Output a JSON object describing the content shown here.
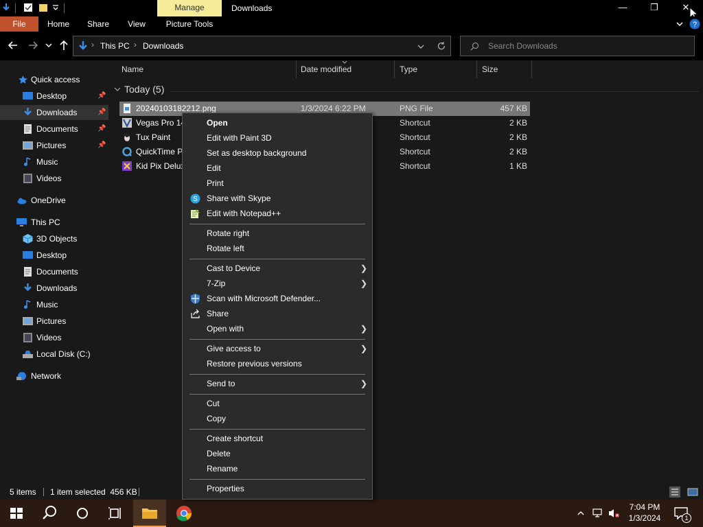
{
  "window": {
    "manage_tab": "Manage",
    "title": "Downloads",
    "minimize": "—",
    "restore": "❐",
    "close": "✕"
  },
  "ribbon": {
    "file": "File",
    "home": "Home",
    "share": "Share",
    "view": "View",
    "picture_tools": "Picture Tools"
  },
  "address": {
    "crumbs": [
      "This PC",
      "Downloads"
    ],
    "search_placeholder": "Search Downloads"
  },
  "nav": {
    "quick_access": "Quick access",
    "qa_items": [
      "Desktop",
      "Downloads",
      "Documents",
      "Pictures",
      "Music",
      "Videos"
    ],
    "onedrive": "OneDrive",
    "this_pc": "This PC",
    "pc_items": [
      "3D Objects",
      "Desktop",
      "Documents",
      "Downloads",
      "Music",
      "Pictures",
      "Videos",
      "Local Disk (C:)"
    ],
    "network": "Network"
  },
  "columns": {
    "name": "Name",
    "date": "Date modified",
    "type": "Type",
    "size": "Size"
  },
  "group": {
    "label": "Today (5)"
  },
  "files": [
    {
      "name": "20240103182212.png",
      "date": "1/3/2024 6:22 PM",
      "type": "PNG File",
      "size": "457 KB"
    },
    {
      "name": "Vegas Pro 14",
      "date": "",
      "type": "Shortcut",
      "size": "2 KB"
    },
    {
      "name": "Tux Paint",
      "date": "",
      "type": "Shortcut",
      "size": "2 KB"
    },
    {
      "name": "QuickTime P",
      "date": "",
      "type": "Shortcut",
      "size": "2 KB"
    },
    {
      "name": "Kid Pix Delux",
      "date": "",
      "type": "Shortcut",
      "size": "1 KB"
    }
  ],
  "menu": {
    "open": "Open",
    "edit_paint3d": "Edit with Paint 3D",
    "set_bg": "Set as desktop background",
    "edit": "Edit",
    "print": "Print",
    "share_skype": "Share with Skype",
    "edit_npp": "Edit with Notepad++",
    "rotate_right": "Rotate right",
    "rotate_left": "Rotate left",
    "cast": "Cast to Device",
    "zip": "7-Zip",
    "defender": "Scan with Microsoft Defender...",
    "share": "Share",
    "open_with": "Open with",
    "give_access": "Give access to",
    "restore_versions": "Restore previous versions",
    "send_to": "Send to",
    "cut": "Cut",
    "copy": "Copy",
    "create_shortcut": "Create shortcut",
    "delete": "Delete",
    "rename": "Rename",
    "properties": "Properties"
  },
  "status": {
    "items": "5 items",
    "selected": "1 item selected  456 KB"
  },
  "clock": {
    "time": "7:04 PM",
    "date": "1/3/2024"
  },
  "notifications": {
    "count": "1"
  }
}
